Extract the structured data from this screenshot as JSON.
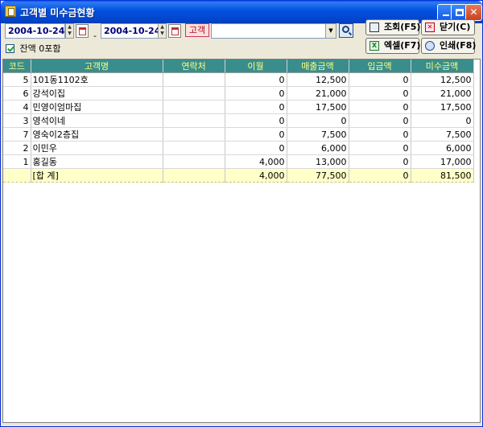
{
  "window": {
    "title": "고객별 미수금현황"
  },
  "toolbar": {
    "date_from": "2004-10-24",
    "date_to": "2004-10-24",
    "date_separator": "-",
    "customer_button": "고객",
    "customer_value": "",
    "include_zero_balance_label": "잔액 0포함",
    "include_zero_balance_checked": true,
    "buttons": {
      "search": "조회(F5)",
      "close": "닫기(C)",
      "excel": "엑셀(F7)",
      "print": "인쇄(F8)"
    }
  },
  "grid": {
    "columns": [
      "코드",
      "고객명",
      "연락처",
      "이월",
      "매출금액",
      "입금액",
      "미수금액"
    ],
    "rows": [
      {
        "code": "5",
        "name": "101동1102호",
        "contact": "",
        "carryover": "0",
        "sales": "12,500",
        "deposit": "0",
        "receivable": "12,500"
      },
      {
        "code": "6",
        "name": "강석이집",
        "contact": "",
        "carryover": "0",
        "sales": "21,000",
        "deposit": "0",
        "receivable": "21,000"
      },
      {
        "code": "4",
        "name": "민영이엄마집",
        "contact": "",
        "carryover": "0",
        "sales": "17,500",
        "deposit": "0",
        "receivable": "17,500"
      },
      {
        "code": "3",
        "name": "영석이네",
        "contact": "",
        "carryover": "0",
        "sales": "0",
        "deposit": "0",
        "receivable": "0"
      },
      {
        "code": "7",
        "name": "영숙이2층집",
        "contact": "",
        "carryover": "0",
        "sales": "7,500",
        "deposit": "0",
        "receivable": "7,500"
      },
      {
        "code": "2",
        "name": "이민우",
        "contact": "",
        "carryover": "0",
        "sales": "6,000",
        "deposit": "0",
        "receivable": "6,000"
      },
      {
        "code": "1",
        "name": "홍길동",
        "contact": "",
        "carryover": "4,000",
        "sales": "13,000",
        "deposit": "0",
        "receivable": "17,000"
      }
    ],
    "total": {
      "code": "",
      "name": "[합 계]",
      "contact": "",
      "carryover": "4,000",
      "sales": "77,500",
      "deposit": "0",
      "receivable": "81,500"
    }
  }
}
